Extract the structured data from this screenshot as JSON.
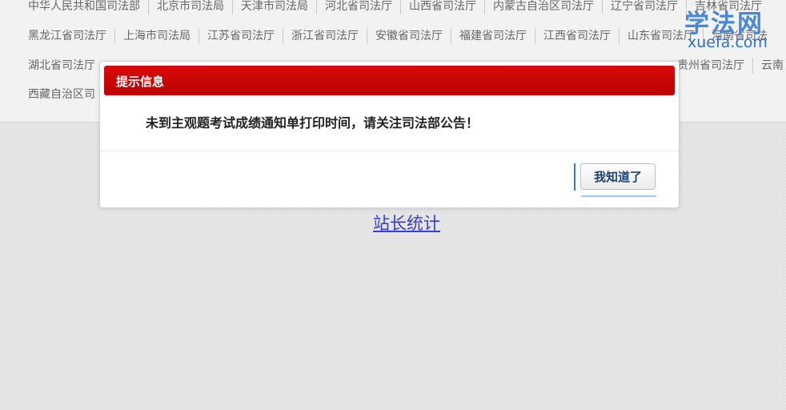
{
  "nav": {
    "rows": [
      [
        "中华人民共和国司法部",
        "北京市司法局",
        "天津市司法局",
        "河北省司法厅",
        "山西省司法厅",
        "内蒙古自治区司法厅",
        "辽宁省司法厅",
        "吉林省司法厅"
      ],
      [
        "黑龙江省司法厅",
        "上海市司法局",
        "江苏省司法厅",
        "浙江省司法厅",
        "安徽省司法厅",
        "福建省司法厅",
        "江西省司法厅",
        "山东省司法厅",
        "河南省司法"
      ],
      [
        "湖北省司法厅",
        "",
        "",
        "",
        "",
        "",
        "",
        "贵州省司法厅",
        "云南"
      ],
      [
        "西藏自治区司"
      ]
    ]
  },
  "logo": {
    "cn": "学法网",
    "en": "xuefa.com"
  },
  "stats_link": "站长统计",
  "dialog": {
    "title": "提示信息",
    "message": "未到主观题考试成绩通知单打印时间，请关注司法部公告！",
    "ok_label": "我知道了"
  },
  "colors": {
    "header_red": "#c80000",
    "link_blue": "#3b3bc6",
    "logo_blue": "#4a88d4"
  }
}
